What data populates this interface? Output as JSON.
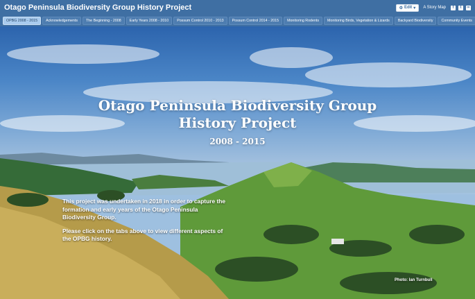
{
  "header": {
    "title": "Otago Peninsula Biodiversity Group History Project",
    "edit_label": "Edit",
    "story_map_label": "A Story Map",
    "social_icons": [
      "facebook-icon",
      "twitter-icon",
      "link-icon"
    ]
  },
  "tabs": [
    {
      "label": "OPBG 2008 - 2015",
      "active": true
    },
    {
      "label": "Acknowledgements",
      "active": false
    },
    {
      "label": "The Beginning - 2008",
      "active": false
    },
    {
      "label": "Early Years 2008 - 2010",
      "active": false
    },
    {
      "label": "Possum Control 2010 - 2013",
      "active": false
    },
    {
      "label": "Possum Control 2014 - 2015",
      "active": false
    },
    {
      "label": "Monitoring Rodents",
      "active": false
    },
    {
      "label": "Monitoring Birds, Vegetation & Lizards",
      "active": false
    },
    {
      "label": "Backyard Biodiversity",
      "active": false
    },
    {
      "label": "Community Events",
      "active": false
    }
  ],
  "hero": {
    "title_line1": "Otago Peninsula Biodiversity Group",
    "title_line2": "History Project",
    "subtitle": "2008 - 2015",
    "intro_paragraph1": "This project was undertaken in 2018 in order to capture the formation and early years of the Otago Peninsula Biodiversity Group.",
    "intro_paragraph2": "Please click on the tabs above to view different aspects of the OPBG history.",
    "photo_credit": "Photo: Ian Turnbull"
  },
  "colors": {
    "header_bg": "#3f6fa3",
    "active_tab": "#a9cbee",
    "tab_bg": "#4e7db0"
  }
}
